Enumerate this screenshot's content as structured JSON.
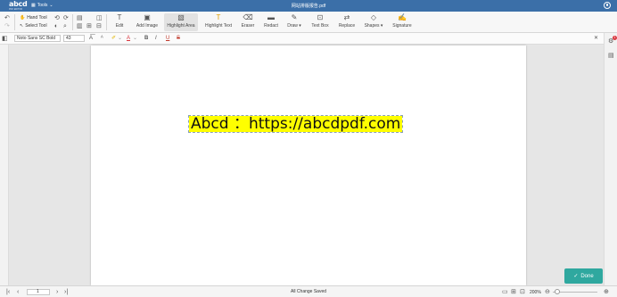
{
  "app": {
    "logo": "abcd",
    "logo_sub": "PDF EDITOR",
    "tools_menu": "Tools",
    "document_title": "网站排版报告.pdf"
  },
  "ribbon": {
    "hand_tool": "Hand Tool",
    "select_tool": "Select Tool",
    "tools": [
      {
        "label": "Edit",
        "icon": "edit-icon"
      },
      {
        "label": "Add Image",
        "icon": "image-icon"
      },
      {
        "label": "Highlight Area",
        "icon": "highlight-area-icon"
      },
      {
        "label": "Highlight Text",
        "icon": "highlight-text-icon"
      },
      {
        "label": "Eraser",
        "icon": "eraser-icon"
      },
      {
        "label": "Redact",
        "icon": "redact-icon"
      },
      {
        "label": "Draw",
        "icon": "pen-icon"
      },
      {
        "label": "Text Box",
        "icon": "textbox-icon"
      },
      {
        "label": "Replace",
        "icon": "replace-icon"
      },
      {
        "label": "Shapes",
        "icon": "shapes-icon"
      },
      {
        "label": "Signature",
        "icon": "signature-icon"
      }
    ],
    "active_tool": "Highlight Area"
  },
  "format_bar": {
    "font": "Noto Sans SC Bold",
    "font_size": "43",
    "bold": "B",
    "italic": "I",
    "underline": "U",
    "strikethrough": "S",
    "text_color_letter": "A"
  },
  "document": {
    "text": "Abcd ：https://abcdpdf.com",
    "highlight_color": "#ffff00"
  },
  "done_button": "Done",
  "status": {
    "page_number": "1",
    "save_status": "All Change Saved",
    "zoom": "200%"
  },
  "notification_count": "1",
  "colors": {
    "brand": "#3b6fa8",
    "done": "#2fa89f",
    "alert": "#d9363e"
  }
}
